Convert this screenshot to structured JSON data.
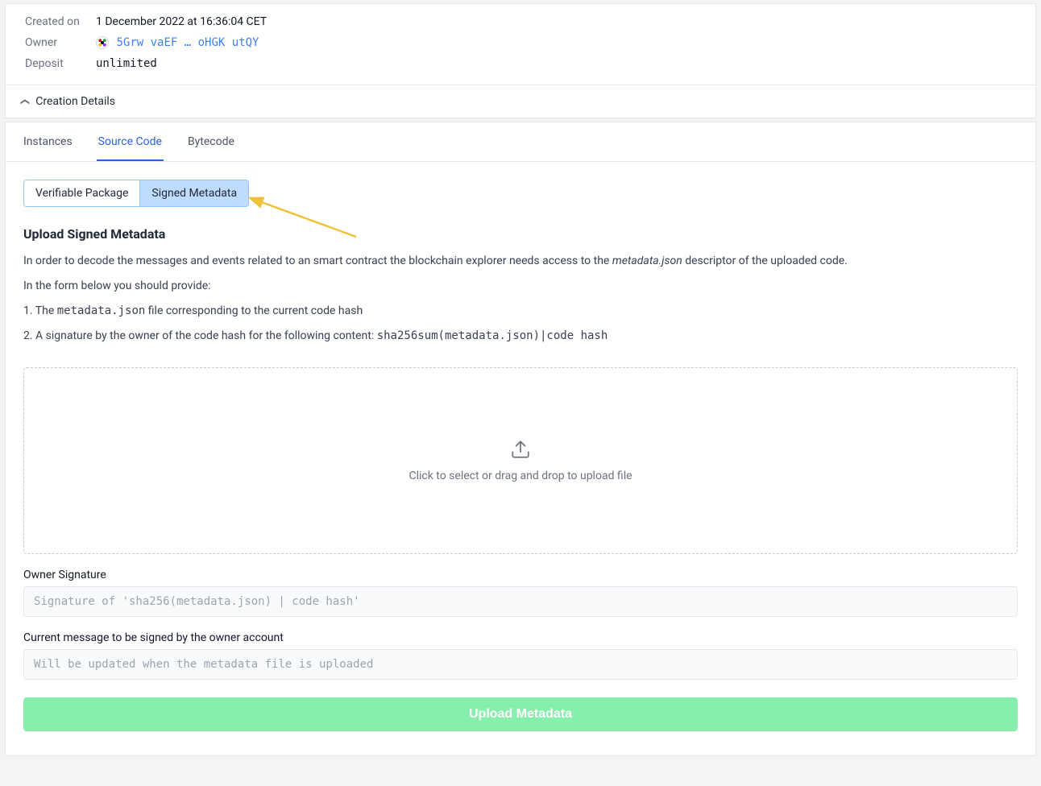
{
  "details": {
    "created_on_label": "Created on",
    "created_on_value": "1 December 2022 at 16:36:04 CET",
    "owner_label": "Owner",
    "owner_value": "5Grw vaEF … oHGK utQY",
    "deposit_label": "Deposit",
    "deposit_value": "unlimited"
  },
  "collapse": {
    "creation_details": "Creation Details"
  },
  "tabs": {
    "instances": "Instances",
    "source_code": "Source Code",
    "bytecode": "Bytecode"
  },
  "subtabs": {
    "verifiable_package": "Verifiable Package",
    "signed_metadata": "Signed Metadata"
  },
  "upload": {
    "title": "Upload Signed Metadata",
    "intro_pre": "In order to decode the messages and events related to an smart contract the blockchain explorer needs access to the ",
    "intro_em": "metadata.json",
    "intro_post": " descriptor of the uploaded code.",
    "form_intro": "In the form below you should provide:",
    "step1_pre": "1. The ",
    "step1_code": "metadata.json",
    "step1_post": " file corresponding to the current code hash",
    "step2_pre": "2. A signature by the owner of the code hash for the following content: ",
    "step2_code": "sha256sum(metadata.json)|code hash",
    "dropzone_text": "Click to select or drag and drop to upload file",
    "owner_signature_label": "Owner Signature",
    "owner_signature_placeholder": "Signature of 'sha256(metadata.json) | code hash'",
    "current_message_label": "Current message to be signed by the owner account",
    "current_message_placeholder": "Will be updated when the metadata file is uploaded",
    "submit_label": "Upload Metadata"
  }
}
